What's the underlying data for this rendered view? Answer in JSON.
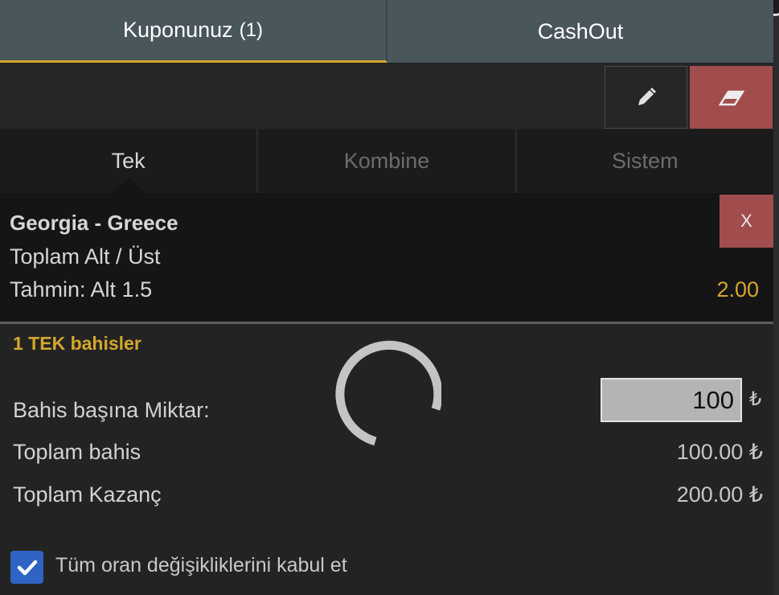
{
  "top_tabs": [
    {
      "label": "Kuponunuz",
      "count": "(1)",
      "active": true
    },
    {
      "label": "CashOut",
      "active": false
    }
  ],
  "toolbar": {
    "edit_icon": "pencil-icon",
    "clear_icon": "eraser-icon"
  },
  "bet_types": [
    "Tek",
    "Kombine",
    "Sistem"
  ],
  "selection": {
    "match": "Georgia - Greece",
    "market": "Toplam Alt / Üst",
    "prediction": "Tahmin: Alt 1.5",
    "odds": "2.00",
    "remove_label": "X"
  },
  "summary": {
    "header": "1 TEK bahisler",
    "stake_label": "Bahis başına Miktar:",
    "stake_value": "100",
    "currency": "₺",
    "total_stake_label": "Toplam bahis",
    "total_stake_value": "100.00 ₺",
    "total_win_label": "Toplam Kazanç",
    "total_win_value": "200.00 ₺"
  },
  "accept_changes": {
    "label": "Tüm oran değişikliklerini kabul et",
    "checked": true
  },
  "colors": {
    "accent": "#d4a72c",
    "danger": "#a14d4d",
    "checkbox": "#2f63c4",
    "tab_bar": "#49565c"
  }
}
